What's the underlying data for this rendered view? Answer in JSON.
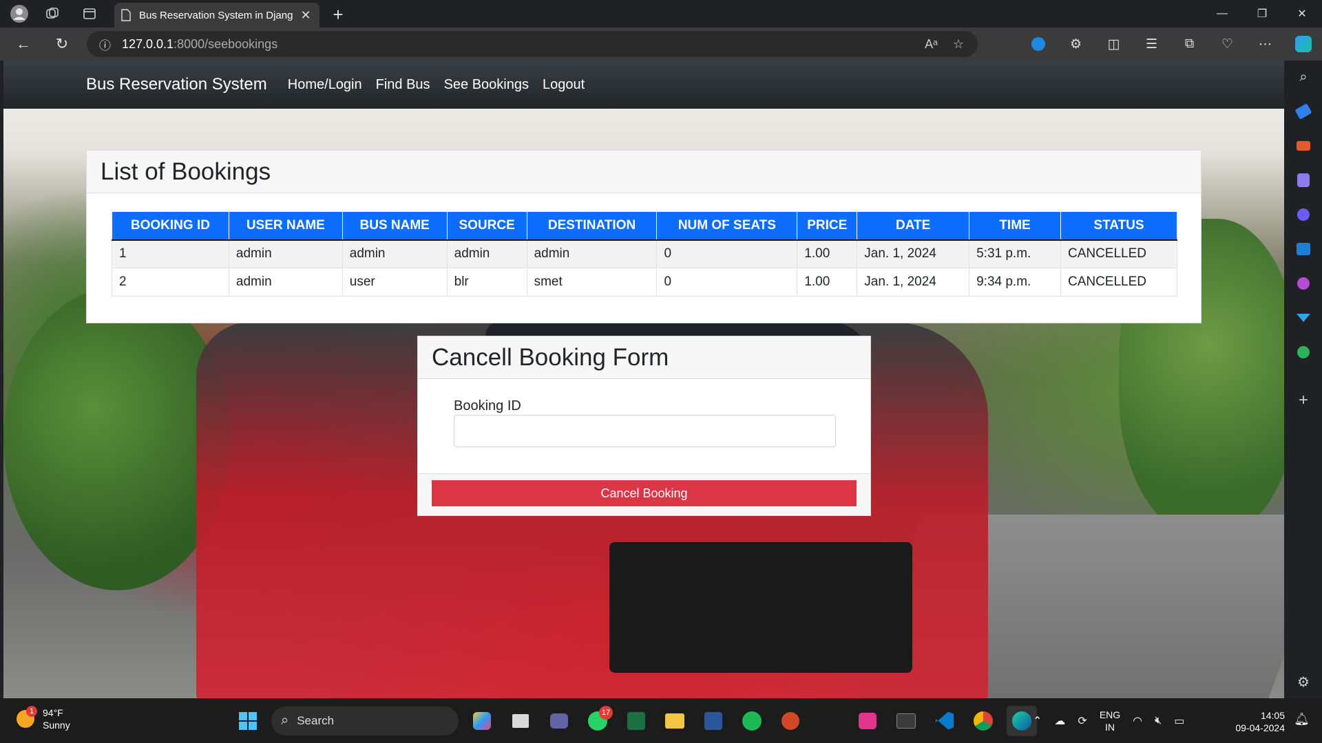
{
  "browser": {
    "tab_title": "Bus Reservation System in Djang",
    "url_host": "127.0.0.1",
    "url_path": ":8000/seebookings",
    "read_aloud_icon": "Aᵃ"
  },
  "navbar": {
    "brand": "Bus Reservation System",
    "links": [
      "Home/Login",
      "Find Bus",
      "See Bookings",
      "Logout"
    ]
  },
  "bookings": {
    "title": "List of Bookings",
    "columns": [
      "BOOKING ID",
      "USER NAME",
      "BUS NAME",
      "SOURCE",
      "DESTINATION",
      "NUM OF SEATS",
      "PRICE",
      "DATE",
      "TIME",
      "STATUS"
    ],
    "rows": [
      [
        "1",
        "admin",
        "admin",
        "admin",
        "admin",
        "0",
        "1.00",
        "Jan. 1, 2024",
        "5:31 p.m.",
        "CANCELLED"
      ],
      [
        "2",
        "admin",
        "user",
        "blr",
        "smet",
        "0",
        "1.00",
        "Jan. 1, 2024",
        "9:34 p.m.",
        "CANCELLED"
      ]
    ]
  },
  "cancel_form": {
    "title": "Cancell Booking Form",
    "field_label": "Booking ID",
    "field_value": "",
    "button_label": "Cancel Booking"
  },
  "taskbar": {
    "weather_temp": "94°F",
    "weather_desc": "Sunny",
    "weather_badge": "1",
    "search_label": "Search",
    "whatsapp_badge": "17",
    "lang_top": "ENG",
    "lang_bottom": "IN",
    "time": "14:05",
    "date": "09-04-2024"
  },
  "colors": {
    "table_header": "#0d6efd",
    "cancel_button": "#dc3545",
    "navbar": "#212529"
  }
}
